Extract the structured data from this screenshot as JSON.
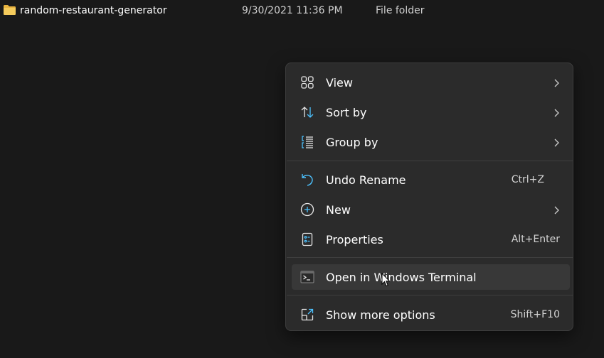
{
  "file": {
    "icon": "folder-icon",
    "name": "random-restaurant-generator",
    "date_modified": "9/30/2021 11:36 PM",
    "type": "File folder"
  },
  "context_menu": {
    "items": [
      {
        "icon": "view-icon",
        "label": "View",
        "submenu": true
      },
      {
        "icon": "sort-icon",
        "label": "Sort by",
        "submenu": true
      },
      {
        "icon": "group-icon",
        "label": "Group by",
        "submenu": true
      },
      {
        "icon": "undo-icon",
        "label": "Undo Rename",
        "shortcut": "Ctrl+Z"
      },
      {
        "icon": "new-icon",
        "label": "New",
        "submenu": true
      },
      {
        "icon": "properties-icon",
        "label": "Properties",
        "shortcut": "Alt+Enter"
      },
      {
        "icon": "terminal-icon",
        "label": "Open in Windows Terminal",
        "highlighted": true
      },
      {
        "icon": "more-options-icon",
        "label": "Show more options",
        "shortcut": "Shift+F10"
      }
    ]
  },
  "colors": {
    "background": "#191919",
    "menu_background": "#2b2b2b",
    "highlight": "#383838",
    "accent_icon": "#4cc2ff",
    "folder": "#f0c14b"
  }
}
